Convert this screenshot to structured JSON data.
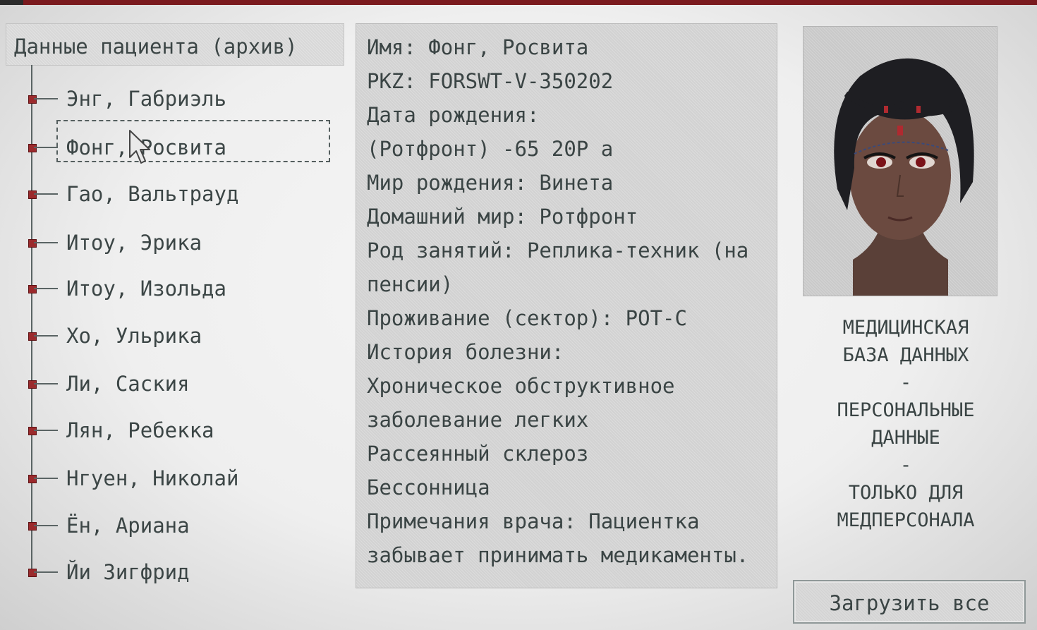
{
  "header": {
    "title": "Данные пациента (архив)"
  },
  "patients": [
    {
      "label": "Энг, Габриэль",
      "selected": false
    },
    {
      "label": "Фонг, Росвита",
      "selected": true
    },
    {
      "label": "Гао, Вальтрауд",
      "selected": false
    },
    {
      "label": "Итоу, Эрика",
      "selected": false
    },
    {
      "label": "Итоу, Изольда",
      "selected": false
    },
    {
      "label": "Хо, Ульрика",
      "selected": false
    },
    {
      "label": "Ли, Саския",
      "selected": false
    },
    {
      "label": "Лян, Ребекка",
      "selected": false
    },
    {
      "label": "Нгуен, Николай",
      "selected": false
    },
    {
      "label": "Ён, Ариана",
      "selected": false
    },
    {
      "label": "Йи Зигфрид",
      "selected": false
    }
  ],
  "details": {
    "lines": [
      "Имя: Фонг, Росвита",
      "PKZ: FORSWT-V-350202",
      "Дата рождения:",
      "(Ротфронт) -65 20P a",
      "Мир рождения: Винета",
      "Домашний мир: Ротфронт",
      "Род занятий: Реплика-техник (на",
      "пенсии)",
      "Проживание (сектор): РОТ-С",
      "История болезни:",
      "Хроническое обструктивное",
      "заболевание легких",
      "Рассеянный склероз",
      "Бессонница",
      "Примечания врача: Пациентка",
      "забывает принимать медикаменты."
    ]
  },
  "side_panel": {
    "title_lines": [
      "МЕДИЦИНСКАЯ",
      "БАЗА ДАННЫХ",
      "-",
      "ПЕРСОНАЛЬНЫЕ",
      "ДАННЫЕ",
      "-",
      "ТОЛЬКО ДЛЯ",
      "МЕДПЕРСОНАЛА"
    ],
    "load_button": "Загрузить все"
  },
  "colors": {
    "frame_red": "#7a1a1e",
    "node_red": "#9b2a2c",
    "panel_grey": "#d2d2d2",
    "text": "#3a4444"
  }
}
